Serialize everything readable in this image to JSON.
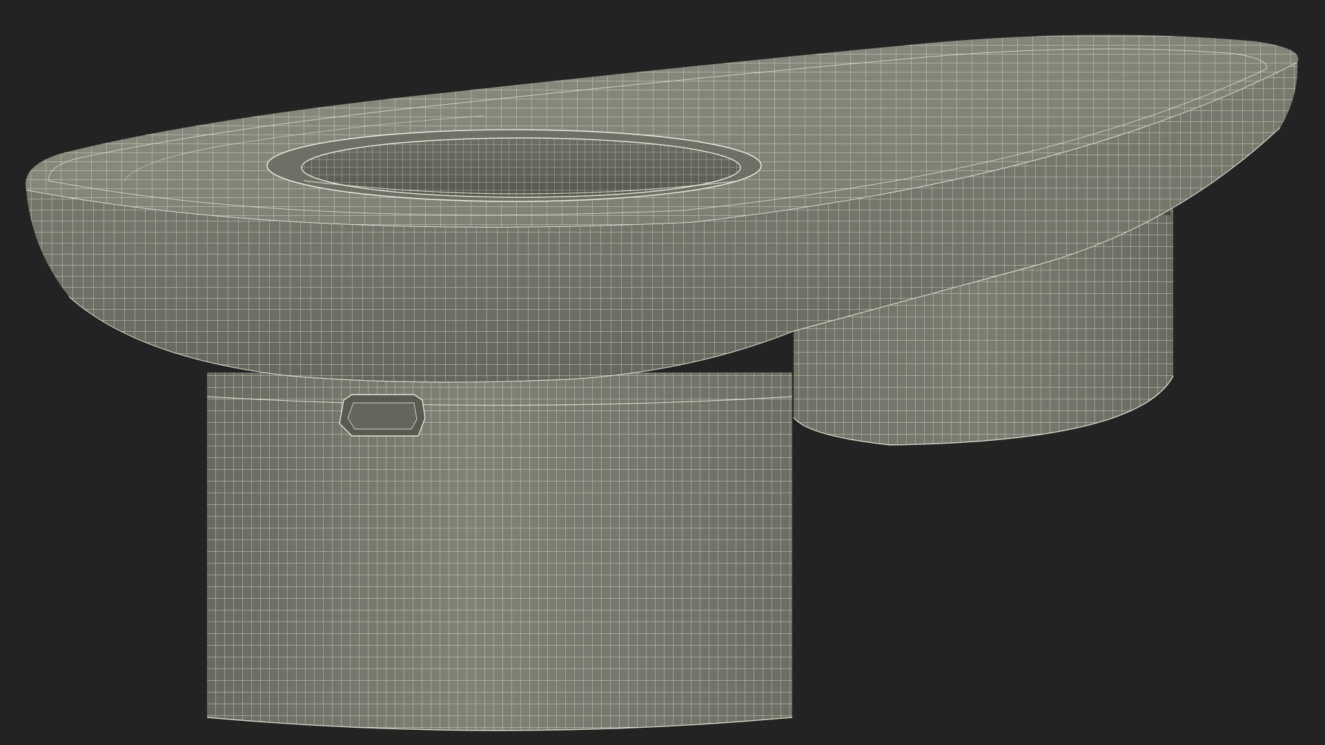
{
  "scene": {
    "subject": "table-wireframe-render",
    "colors": {
      "background": "#232323",
      "surface": "#7d7d72",
      "surface_light": "#8a8a7e",
      "surface_dark": "#66665d",
      "shadow": "#4e4e47",
      "wire": "#e9e7d8"
    }
  }
}
